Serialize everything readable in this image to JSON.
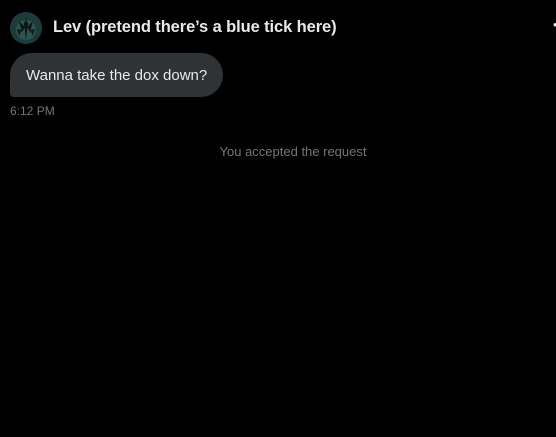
{
  "conversation": {
    "contact_name": "Lev (pretend there’s a blue tick here)",
    "avatar_icon": "avatar-image-icon"
  },
  "messages": [
    {
      "text": "Wanna take the dox down?",
      "time": "6:12 PM",
      "direction": "incoming"
    }
  ],
  "system_note": "You accepted the request",
  "colors": {
    "background": "#000000",
    "bubble": "#2f3336",
    "primary_text": "#e7e9ea",
    "muted_text": "#71767b"
  }
}
